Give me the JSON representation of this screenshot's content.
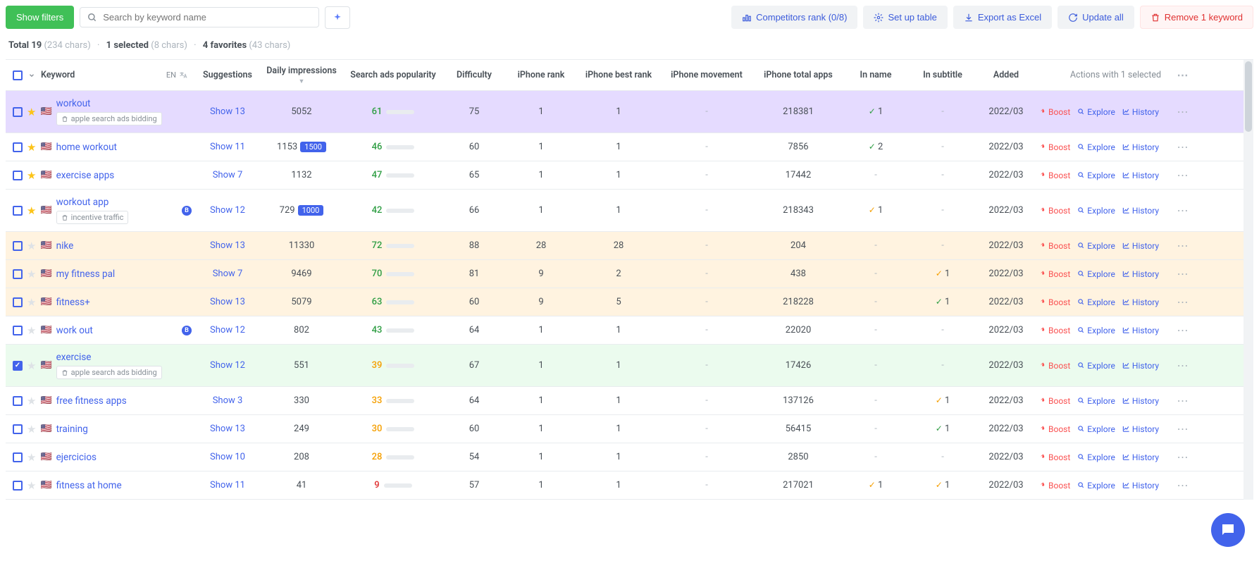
{
  "toolbar": {
    "show_filters": "Show filters",
    "search_placeholder": "Search by keyword name",
    "competitors": "Competitors rank (0/8)",
    "setup": "Set up table",
    "export": "Export as Excel",
    "update": "Update all",
    "remove": "Remove 1 keyword"
  },
  "stats": {
    "total_label": "Total 19",
    "total_chars": "(234 chars)",
    "selected_label": "1 selected",
    "selected_chars": "(8 chars)",
    "favorites_label": "4 favorites",
    "favorites_chars": "(43 chars)"
  },
  "headers": {
    "keyword": "Keyword",
    "lang": "EN",
    "suggestions": "Suggestions",
    "daily_impressions": "Daily impressions",
    "search_ads": "Search ads popularity",
    "difficulty": "Difficulty",
    "iphone_rank": "iPhone rank",
    "iphone_best": "iPhone best rank",
    "iphone_move": "iPhone movement",
    "iphone_total": "iPhone total apps",
    "in_name": "In name",
    "in_subtitle": "In subtitle",
    "added": "Added",
    "actions": "Actions with 1 selected"
  },
  "action_labels": {
    "boost": "Boost",
    "explore": "Explore",
    "history": "History"
  },
  "rows": [
    {
      "selected": false,
      "fav": true,
      "flag": "🇺🇸",
      "kw": "workout",
      "tag": "apple search ads bidding",
      "tag_icon": "trash",
      "sugg": "Show 13",
      "di": "5052",
      "di_badge": "",
      "pop": 61,
      "pop_cls": "green",
      "diff": "75",
      "rank": "1",
      "best": "1",
      "move": "-",
      "total": "218381",
      "in_name": "1",
      "in_name_cls": "green",
      "in_sub": "-",
      "added": "2022/03",
      "row_cls": "purple tall",
      "b": false
    },
    {
      "selected": false,
      "fav": true,
      "flag": "🇺🇸",
      "kw": "home workout",
      "tag": "",
      "sugg": "Show 11",
      "di": "1153",
      "di_badge": "1500",
      "pop": 46,
      "pop_cls": "green",
      "diff": "60",
      "rank": "1",
      "best": "1",
      "move": "-",
      "total": "7856",
      "in_name": "2",
      "in_name_cls": "green",
      "in_sub": "-",
      "added": "2022/03",
      "row_cls": "",
      "b": false
    },
    {
      "selected": false,
      "fav": true,
      "flag": "🇺🇸",
      "kw": "exercise apps",
      "tag": "",
      "sugg": "Show 7",
      "di": "1132",
      "di_badge": "",
      "pop": 47,
      "pop_cls": "green",
      "diff": "65",
      "rank": "1",
      "best": "1",
      "move": "-",
      "total": "17442",
      "in_name": "-",
      "in_name_cls": "",
      "in_sub": "-",
      "added": "2022/03",
      "row_cls": "",
      "b": false
    },
    {
      "selected": false,
      "fav": true,
      "flag": "🇺🇸",
      "kw": "workout app",
      "tag": "incentive traffic",
      "tag_icon": "trash",
      "sugg": "Show 12",
      "di": "729",
      "di_badge": "1000",
      "pop": 42,
      "pop_cls": "green",
      "diff": "66",
      "rank": "1",
      "best": "1",
      "move": "-",
      "total": "218343",
      "in_name": "1",
      "in_name_cls": "orange",
      "in_sub": "-",
      "added": "2022/03",
      "row_cls": "tall",
      "b": true
    },
    {
      "selected": false,
      "fav": false,
      "flag": "🇺🇸",
      "kw": "nike",
      "tag": "",
      "sugg": "Show 13",
      "di": "11330",
      "di_badge": "",
      "pop": 72,
      "pop_cls": "green",
      "diff": "88",
      "rank": "28",
      "best": "28",
      "move": "-",
      "total": "204",
      "in_name": "-",
      "in_name_cls": "",
      "in_sub": "-",
      "added": "2022/03",
      "row_cls": "yellow",
      "b": false
    },
    {
      "selected": false,
      "fav": false,
      "flag": "🇺🇸",
      "kw": "my fitness pal",
      "tag": "",
      "sugg": "Show 7",
      "di": "9469",
      "di_badge": "",
      "pop": 70,
      "pop_cls": "green",
      "diff": "81",
      "rank": "9",
      "best": "2",
      "move": "-",
      "total": "438",
      "in_name": "-",
      "in_name_cls": "",
      "in_sub": "1",
      "in_sub_cls": "orange",
      "added": "2022/03",
      "row_cls": "yellow",
      "b": false
    },
    {
      "selected": false,
      "fav": false,
      "flag": "🇺🇸",
      "kw": "fitness+",
      "tag": "",
      "sugg": "Show 13",
      "di": "5079",
      "di_badge": "",
      "pop": 63,
      "pop_cls": "green",
      "diff": "60",
      "rank": "9",
      "best": "5",
      "move": "-",
      "total": "218228",
      "in_name": "-",
      "in_name_cls": "",
      "in_sub": "1",
      "in_sub_cls": "green",
      "added": "2022/03",
      "row_cls": "yellow",
      "b": false
    },
    {
      "selected": false,
      "fav": false,
      "flag": "🇺🇸",
      "kw": "work out",
      "tag": "",
      "sugg": "Show 12",
      "di": "802",
      "di_badge": "",
      "pop": 43,
      "pop_cls": "green",
      "diff": "64",
      "rank": "1",
      "best": "1",
      "move": "-",
      "total": "22020",
      "in_name": "-",
      "in_name_cls": "",
      "in_sub": "-",
      "added": "2022/03",
      "row_cls": "",
      "b": true
    },
    {
      "selected": true,
      "fav": false,
      "flag": "🇺🇸",
      "kw": "exercise",
      "tag": "apple search ads bidding",
      "tag_icon": "trash",
      "sugg": "Show 12",
      "di": "551",
      "di_badge": "",
      "pop": 39,
      "pop_cls": "orange",
      "diff": "67",
      "rank": "1",
      "best": "1",
      "move": "-",
      "total": "17426",
      "in_name": "-",
      "in_name_cls": "",
      "in_sub": "-",
      "added": "2022/03",
      "row_cls": "green-bg tall",
      "b": false
    },
    {
      "selected": false,
      "fav": false,
      "flag": "🇺🇸",
      "kw": "free fitness apps",
      "tag": "",
      "sugg": "Show 3",
      "di": "330",
      "di_badge": "",
      "pop": 33,
      "pop_cls": "orange",
      "diff": "64",
      "rank": "1",
      "best": "1",
      "move": "-",
      "total": "137126",
      "in_name": "-",
      "in_name_cls": "",
      "in_sub": "1",
      "in_sub_cls": "orange",
      "added": "2022/03",
      "row_cls": "",
      "b": false
    },
    {
      "selected": false,
      "fav": false,
      "flag": "🇺🇸",
      "kw": "training",
      "tag": "",
      "sugg": "Show 13",
      "di": "249",
      "di_badge": "",
      "pop": 30,
      "pop_cls": "orange",
      "diff": "60",
      "rank": "1",
      "best": "1",
      "move": "-",
      "total": "56415",
      "in_name": "-",
      "in_name_cls": "",
      "in_sub": "1",
      "in_sub_cls": "green",
      "added": "2022/03",
      "row_cls": "",
      "b": false
    },
    {
      "selected": false,
      "fav": false,
      "flag": "🇺🇸",
      "kw": "ejercicios",
      "tag": "",
      "sugg": "Show 10",
      "di": "208",
      "di_badge": "",
      "pop": 28,
      "pop_cls": "orange",
      "diff": "54",
      "rank": "1",
      "best": "1",
      "move": "-",
      "total": "2850",
      "in_name": "-",
      "in_name_cls": "",
      "in_sub": "-",
      "added": "2022/03",
      "row_cls": "",
      "b": false
    },
    {
      "selected": false,
      "fav": false,
      "flag": "🇺🇸",
      "kw": "fitness at home",
      "tag": "",
      "sugg": "Show 11",
      "di": "41",
      "di_badge": "",
      "pop": 9,
      "pop_cls": "red",
      "diff": "57",
      "rank": "1",
      "best": "1",
      "move": "-",
      "total": "217021",
      "in_name": "1",
      "in_name_cls": "orange",
      "in_sub": "1",
      "in_sub_cls": "orange",
      "added": "2022/03",
      "row_cls": "",
      "b": false
    }
  ]
}
